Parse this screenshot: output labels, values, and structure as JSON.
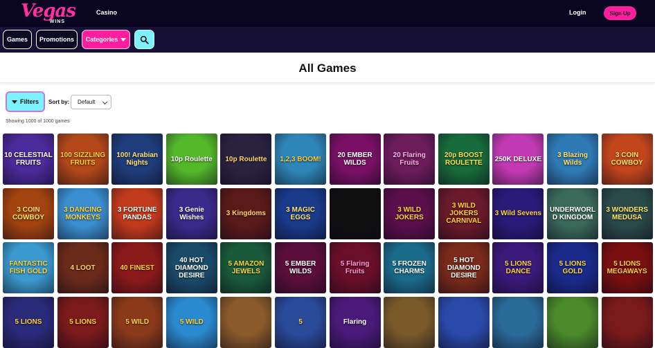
{
  "header": {
    "logo_text": "Vegas",
    "logo_sub": "WINS",
    "casino_link": "Casino",
    "login_link": "Login",
    "signup_button": "Sign Up"
  },
  "subnav": {
    "games": "Games",
    "promotions": "Promotions",
    "categories": "Categories"
  },
  "page": {
    "title": "All Games",
    "filters_button": "Filters",
    "sort_label": "Sort by:",
    "sort_value": "Default",
    "showing_text": "Showing 1000 of 1000 games"
  },
  "colors": {
    "topbar": "#0a0520",
    "subnav": "#171138",
    "accent_pink": "#ff1f9e",
    "accent_cyan": "#7cf2ff"
  },
  "games": [
    {
      "title": "10 CELESTIAL FRUITS",
      "bg": "#4b2a9a",
      "fg": "#ffffff"
    },
    {
      "title": "100 SIZZLING FRUITS",
      "bg": "#b3471a",
      "fg": "#ffd23a"
    },
    {
      "title": "100! Arabian Nights",
      "bg": "#1f3d7a",
      "fg": "#ffe27a"
    },
    {
      "title": "10p Roulette",
      "bg": "#53b82a",
      "fg": "#ffffff"
    },
    {
      "title": "10p Roulette",
      "bg": "#2a2340",
      "fg": "#ffd36b"
    },
    {
      "title": "1,2,3 BOOM!",
      "bg": "#2e86b8",
      "fg": "#ffc933"
    },
    {
      "title": "20 EMBER WILDS",
      "bg": "#7a1066",
      "fg": "#ffffff"
    },
    {
      "title": "20 Flaring Fruits",
      "bg": "#6d1c5a",
      "fg": "#ffb3e6"
    },
    {
      "title": "20p BOOST ROULETTE",
      "bg": "#176b3a",
      "fg": "#ffdd55"
    },
    {
      "title": "250K DELUXE",
      "bg": "#c23ab3",
      "fg": "#ffffff"
    },
    {
      "title": "3 Blazing Wilds",
      "bg": "#2f7ab5",
      "fg": "#ffe36b"
    },
    {
      "title": "3 COIN COWBOY",
      "bg": "#c2451c",
      "fg": "#ffe36b"
    },
    {
      "title": "3 COIN COWBOY",
      "bg": "#a3430f",
      "fg": "#ffe36b"
    },
    {
      "title": "3 DANCING MONKEYS",
      "bg": "#3a8ecf",
      "fg": "#ffd23a"
    },
    {
      "title": "3 FORTUNE PANDAS",
      "bg": "#c23a1c",
      "fg": "#ffffff"
    },
    {
      "title": "3 Genie Wishes",
      "bg": "#3a2a8a",
      "fg": "#ffffff"
    },
    {
      "title": "3 Kingdoms",
      "bg": "#5a1a1a",
      "fg": "#ffd36b"
    },
    {
      "title": "3 MAGIC EGGS",
      "bg": "#1a3a8a",
      "fg": "#ffe36b"
    },
    {
      "title": "",
      "bg": "#101010",
      "fg": "#ffffff"
    },
    {
      "title": "3 WILD JOKERS",
      "bg": "#5a0f4a",
      "fg": "#ffd23a"
    },
    {
      "title": "3 WILD JOKERS CARNIVAL",
      "bg": "#6a1a2a",
      "fg": "#ffd23a"
    },
    {
      "title": "3 Wild Sevens",
      "bg": "#2a1a7a",
      "fg": "#ffd23a"
    },
    {
      "title": "UNDERWORLD KINGDOM",
      "bg": "#3a6a5a",
      "fg": "#ffffff"
    },
    {
      "title": "3 WONDERS MEDUSA",
      "bg": "#2a4a4a",
      "fg": "#ffe36b"
    },
    {
      "title": "FANTASTIC FISH GOLD",
      "bg": "#3a9acf",
      "fg": "#ffd23a"
    },
    {
      "title": "4 LOOT",
      "bg": "#6a2a1a",
      "fg": "#ffd36b"
    },
    {
      "title": "40 FINEST",
      "bg": "#8a1a1a",
      "fg": "#ffd23a"
    },
    {
      "title": "40 HOT DIAMOND DESIRE",
      "bg": "#1a4a6a",
      "fg": "#ffffff"
    },
    {
      "title": "5 AMAZON JEWELS",
      "bg": "#1a5a3a",
      "fg": "#ffd23a"
    },
    {
      "title": "5 EMBER WILDS",
      "bg": "#5a0f3a",
      "fg": "#ffffff"
    },
    {
      "title": "5 Flaring Fruits",
      "bg": "#6a0f2a",
      "fg": "#ff9ad6"
    },
    {
      "title": "5 FROZEN CHARMS",
      "bg": "#1a6a8a",
      "fg": "#ffffff"
    },
    {
      "title": "5 HOT DIAMOND DESIRE",
      "bg": "#7a2a1a",
      "fg": "#ffffff"
    },
    {
      "title": "5 LIONS DANCE",
      "bg": "#3a1a7a",
      "fg": "#ffd23a"
    },
    {
      "title": "5 LIONS GOLD",
      "bg": "#1a2a8a",
      "fg": "#ffd23a"
    },
    {
      "title": "5 LIONS MEGAWAYS",
      "bg": "#7a0f0f",
      "fg": "#ffd23a"
    },
    {
      "title": "5 LIONS",
      "bg": "#2a2a7a",
      "fg": "#ffd23a"
    },
    {
      "title": "5 LIONS",
      "bg": "#7a1a1a",
      "fg": "#ffd23a"
    },
    {
      "title": "5 WILD",
      "bg": "#8a3a1a",
      "fg": "#ffd23a"
    },
    {
      "title": "5 WILD",
      "bg": "#2a8acf",
      "fg": "#ffd23a"
    },
    {
      "title": "",
      "bg": "#8a5a2a",
      "fg": "#ffffff"
    },
    {
      "title": "5",
      "bg": "#2a4a9a",
      "fg": "#ffd23a"
    },
    {
      "title": "Flaring",
      "bg": "#4a1a7a",
      "fg": "#ffffff"
    },
    {
      "title": "",
      "bg": "#7a5a2a",
      "fg": "#ffffff"
    },
    {
      "title": "",
      "bg": "#2a4aaa",
      "fg": "#ffffff"
    },
    {
      "title": "",
      "bg": "#2a6a9a",
      "fg": "#ffffff"
    },
    {
      "title": "",
      "bg": "#4a8a2a",
      "fg": "#ffffff"
    },
    {
      "title": "",
      "bg": "#7a1a1a",
      "fg": "#ffd23a"
    }
  ]
}
